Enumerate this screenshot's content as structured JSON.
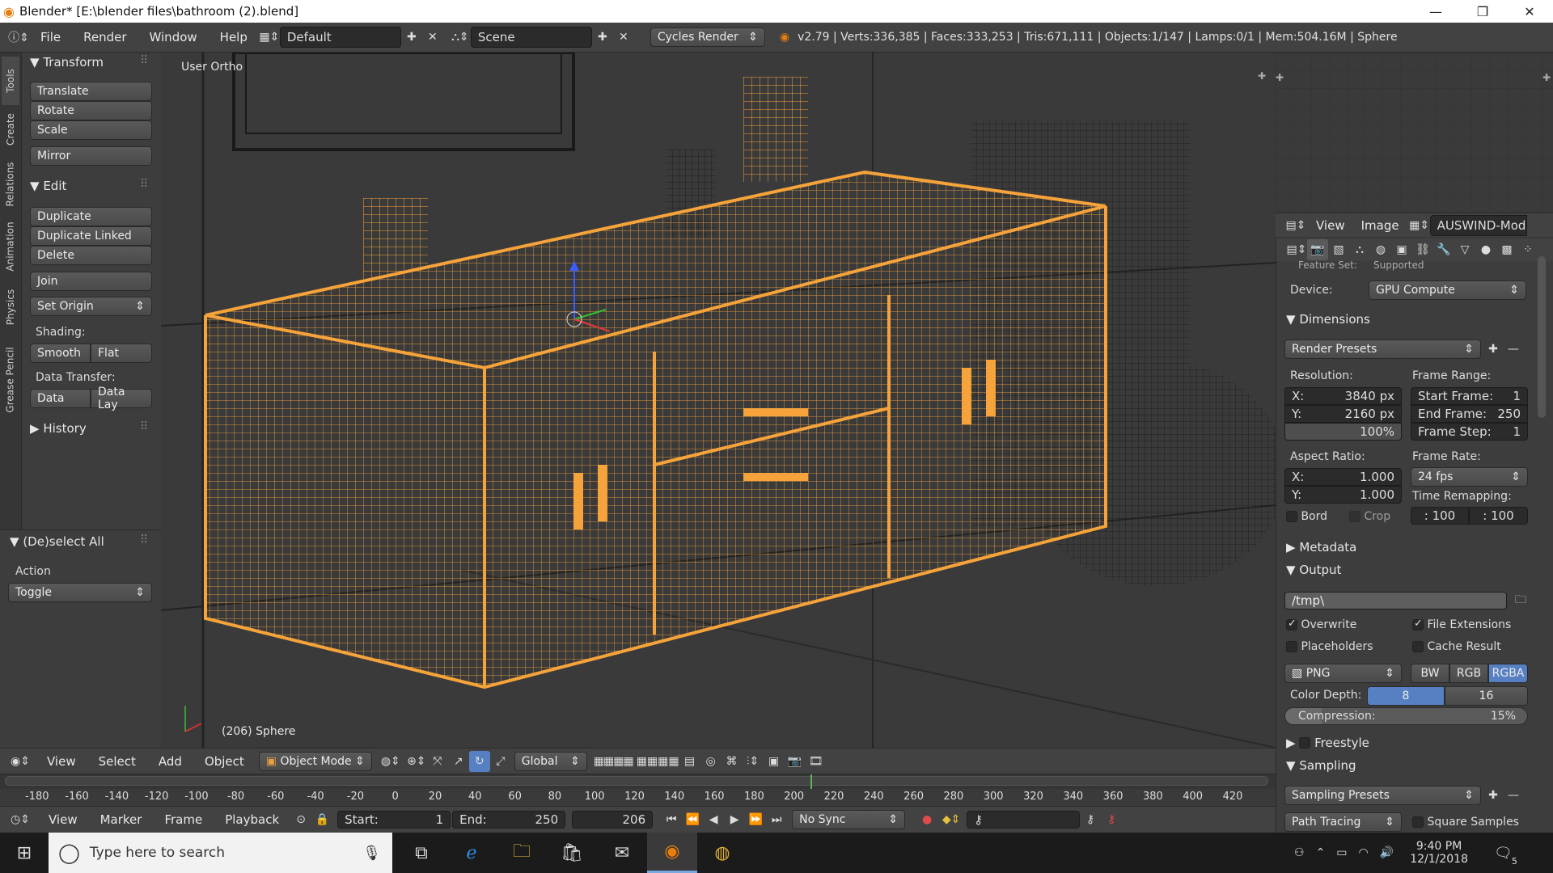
{
  "window": {
    "title": "Blender* [E:\\blender files\\bathroom (2).blend]",
    "min": "—",
    "max": "❐",
    "close": "✕"
  },
  "infobar": {
    "menus": [
      "File",
      "Render",
      "Window",
      "Help"
    ],
    "layout": "Default",
    "scene": "Scene",
    "engine": "Cycles Render",
    "stats": "v2.79 | Verts:336,385 | Faces:333,253 | Tris:671,111 | Objects:1/147 | Lamps:0/1 | Mem:504.16M | Sphere"
  },
  "tooltabs": [
    "Tools",
    "Create",
    "Relations",
    "Animation",
    "Physics",
    "Grease Pencil"
  ],
  "toolshelf": {
    "transform_header": "Transform",
    "translate": "Translate",
    "rotate": "Rotate",
    "scale": "Scale",
    "mirror": "Mirror",
    "edit_header": "Edit",
    "duplicate": "Duplicate",
    "duplicate_linked": "Duplicate Linked",
    "delete": "Delete",
    "join": "Join",
    "set_origin": "Set Origin",
    "shading_label": "Shading:",
    "smooth": "Smooth",
    "flat": "Flat",
    "data_transfer_label": "Data Transfer:",
    "data": "Data",
    "data_lay": "Data Lay",
    "history_header": "History"
  },
  "operator_panel": {
    "header": "(De)select All",
    "action_label": "Action",
    "action_value": "Toggle"
  },
  "viewport": {
    "view_name": "User Ortho",
    "object_info": "(206) Sphere"
  },
  "uv_header": {
    "view": "View",
    "image": "Image",
    "image_name": "AUSWIND-Modern"
  },
  "render": {
    "feature_set_label": "Feature Set:",
    "feature_set_value": "Supported",
    "device_label": "Device:",
    "device_value": "GPU Compute",
    "dimensions_header": "Dimensions",
    "render_presets": "Render Presets",
    "resolution_label": "Resolution:",
    "res_x": "X:",
    "res_x_val": "3840 px",
    "res_y": "Y:",
    "res_y_val": "2160 px",
    "res_pct": "100%",
    "frame_range_label": "Frame Range:",
    "start_frame": "Start Frame:",
    "start_frame_val": "1",
    "end_frame": "End Frame:",
    "end_frame_val": "250",
    "frame_step": "Frame Step:",
    "frame_step_val": "1",
    "aspect_label": "Aspect Ratio:",
    "asp_x": "X:",
    "asp_x_val": "1.000",
    "asp_y": "Y:",
    "asp_y_val": "1.000",
    "frame_rate_label": "Frame Rate:",
    "frame_rate_val": "24 fps",
    "time_remap_label": "Time Remapping:",
    "remap_old": ": 100",
    "remap_new": ": 100",
    "bord": "Bord",
    "crop": "Crop",
    "metadata_header": "Metadata",
    "output_header": "Output",
    "output_path": "/tmp\\",
    "overwrite": "Overwrite",
    "file_ext": "File Extensions",
    "placeholders": "Placeholders",
    "cache_result": "Cache Result",
    "format": "PNG",
    "bw": "BW",
    "rgb": "RGB",
    "rgba": "RGBA",
    "color_depth_label": "Color Depth:",
    "depth_8": "8",
    "depth_16": "16",
    "compression_label": "Compression:",
    "compression_val": "15%",
    "freestyle_header": "Freestyle",
    "sampling_header": "Sampling",
    "sampling_presets": "Sampling Presets",
    "path_tracing": "Path Tracing",
    "square_samples": "Square Samples"
  },
  "view3d_header": {
    "view": "View",
    "select": "Select",
    "add": "Add",
    "object": "Object",
    "mode": "Object Mode",
    "orientation": "Global"
  },
  "ruler_ticks": [
    "-180",
    "-160",
    "-140",
    "-120",
    "-100",
    "-80",
    "-60",
    "-40",
    "-20",
    "0",
    "20",
    "40",
    "60",
    "80",
    "100",
    "120",
    "140",
    "160",
    "180",
    "200",
    "220",
    "240",
    "260",
    "280",
    "300",
    "320",
    "340",
    "360",
    "380",
    "400",
    "420"
  ],
  "timeline": {
    "view": "View",
    "marker": "Marker",
    "frame": "Frame",
    "playback": "Playback",
    "start_label": "Start:",
    "start_val": "1",
    "end_label": "End:",
    "end_val": "250",
    "current": "206",
    "sync": "No Sync"
  },
  "taskbar": {
    "search_placeholder": "Type here to search",
    "time": "9:40 PM",
    "date": "12/1/2018",
    "notif_count": "5"
  },
  "colors": {
    "selection": "#f5a33a",
    "accent_blue": "#5680c2"
  }
}
